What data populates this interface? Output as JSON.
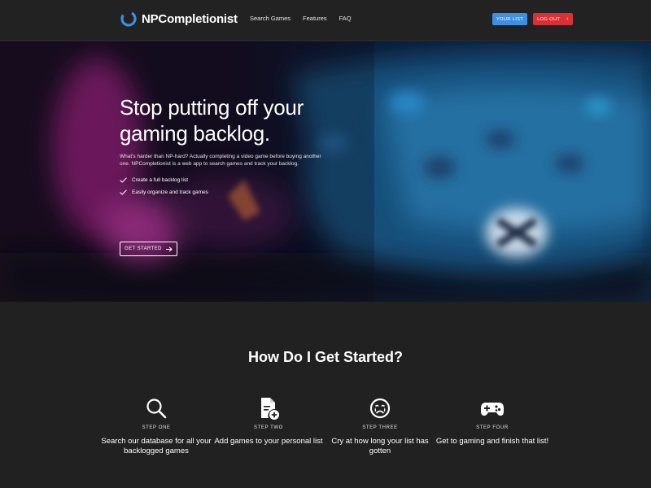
{
  "header": {
    "brand": "NPCompletionist",
    "nav": [
      "Search Games",
      "Features",
      "FAQ"
    ],
    "your_list": "YOUR LIST",
    "log_out": "LOG OUT",
    "colors": {
      "your_list": "#3d8fe3",
      "log_out": "#d83036"
    }
  },
  "hero": {
    "title_line1": "Stop putting off your",
    "title_line2": "gaming backlog.",
    "description": "What's harder than NP-hard? Actually completing a video game before buying another one. NPCompletionist is a web app to search games and track your backlog.",
    "features": [
      "Create a full backlog list",
      "Easily organize and track games"
    ],
    "cta": "GET STARTED"
  },
  "steps_section": {
    "title": "How Do I Get Started?",
    "steps": [
      {
        "icon": "search-icon",
        "label": "STEP ONE",
        "text": "Search our database for all your backlogged games"
      },
      {
        "icon": "add-document-icon",
        "label": "STEP TWO",
        "text": "Add games to your personal list"
      },
      {
        "icon": "crying-face-icon",
        "label": "STEP THREE",
        "text": "Cry at how long your list has gotten"
      },
      {
        "icon": "gamepad-icon",
        "label": "STEP FOUR",
        "text": "Get to gaming and finish that list!"
      }
    ]
  }
}
